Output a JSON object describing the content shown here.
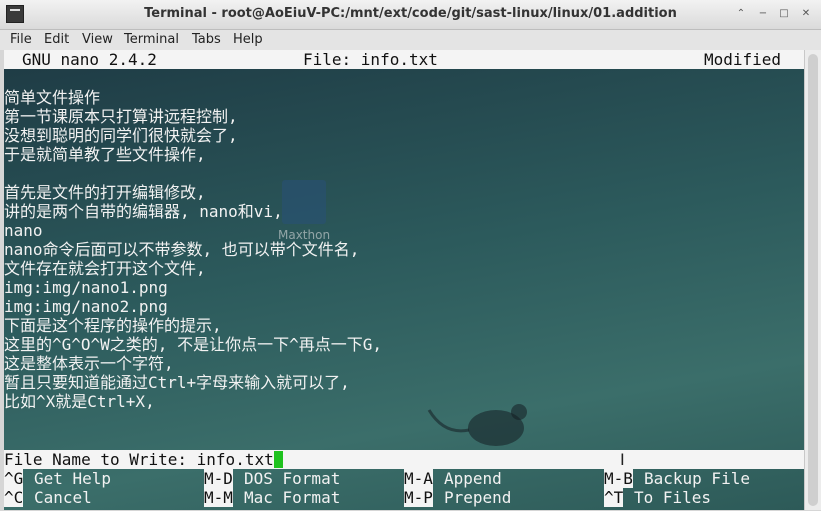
{
  "window": {
    "title": "Terminal - root@AoEiuV-PC:/mnt/ext/code/git/sast-linux/linux/01.addition",
    "buttons": [
      "⌃",
      "−",
      "□",
      "✕"
    ]
  },
  "menu": [
    "File",
    "Edit",
    "View",
    "Terminal",
    "Tabs",
    "Help"
  ],
  "nano": {
    "version": "GNU nano 2.4.2",
    "file": "File: info.txt",
    "status": "Modified"
  },
  "lines": [
    "",
    "简单文件操作",
    "第一节课原本只打算讲远程控制,",
    "没想到聪明的同学们很快就会了,",
    "于是就简单教了些文件操作,",
    "",
    "首先是文件的打开编辑修改,",
    "讲的是两个自带的编辑器, nano和vi,",
    "nano",
    "nano命令后面可以不带参数, 也可以带个文件名,",
    "文件存在就会打开这个文件,",
    "img:img/nano1.png",
    "img:img/nano2.png",
    "下面是这个程序的操作的提示,",
    "这里的^G^O^W之类的, 不是让你点一下^再点一下G,",
    "这是整体表示一个字符,",
    "暂且只要知道能通过Ctrl+字母来输入就可以了,",
    "比如^X就是Ctrl+X,"
  ],
  "prompt": {
    "label": "File Name to Write: ",
    "value": "info.txt"
  },
  "shortcuts": [
    [
      {
        "key": "^G",
        "label": "Get Help"
      },
      {
        "key": "M-D",
        "label": "DOS Format"
      },
      {
        "key": "M-A",
        "label": "Append"
      },
      {
        "key": "M-B",
        "label": "Backup File"
      }
    ],
    [
      {
        "key": "^C",
        "label": "Cancel"
      },
      {
        "key": "M-M",
        "label": "Mac Format"
      },
      {
        "key": "M-P",
        "label": "Prepend"
      },
      {
        "key": "^T",
        "label": "To Files"
      }
    ]
  ],
  "desktop_ghost": {
    "icon_label": "Maxthon"
  },
  "colors": {
    "terminal_bg": "#2c5a5c",
    "bar_bg": "#f4f4f4",
    "cursor": "#1ec21e"
  }
}
